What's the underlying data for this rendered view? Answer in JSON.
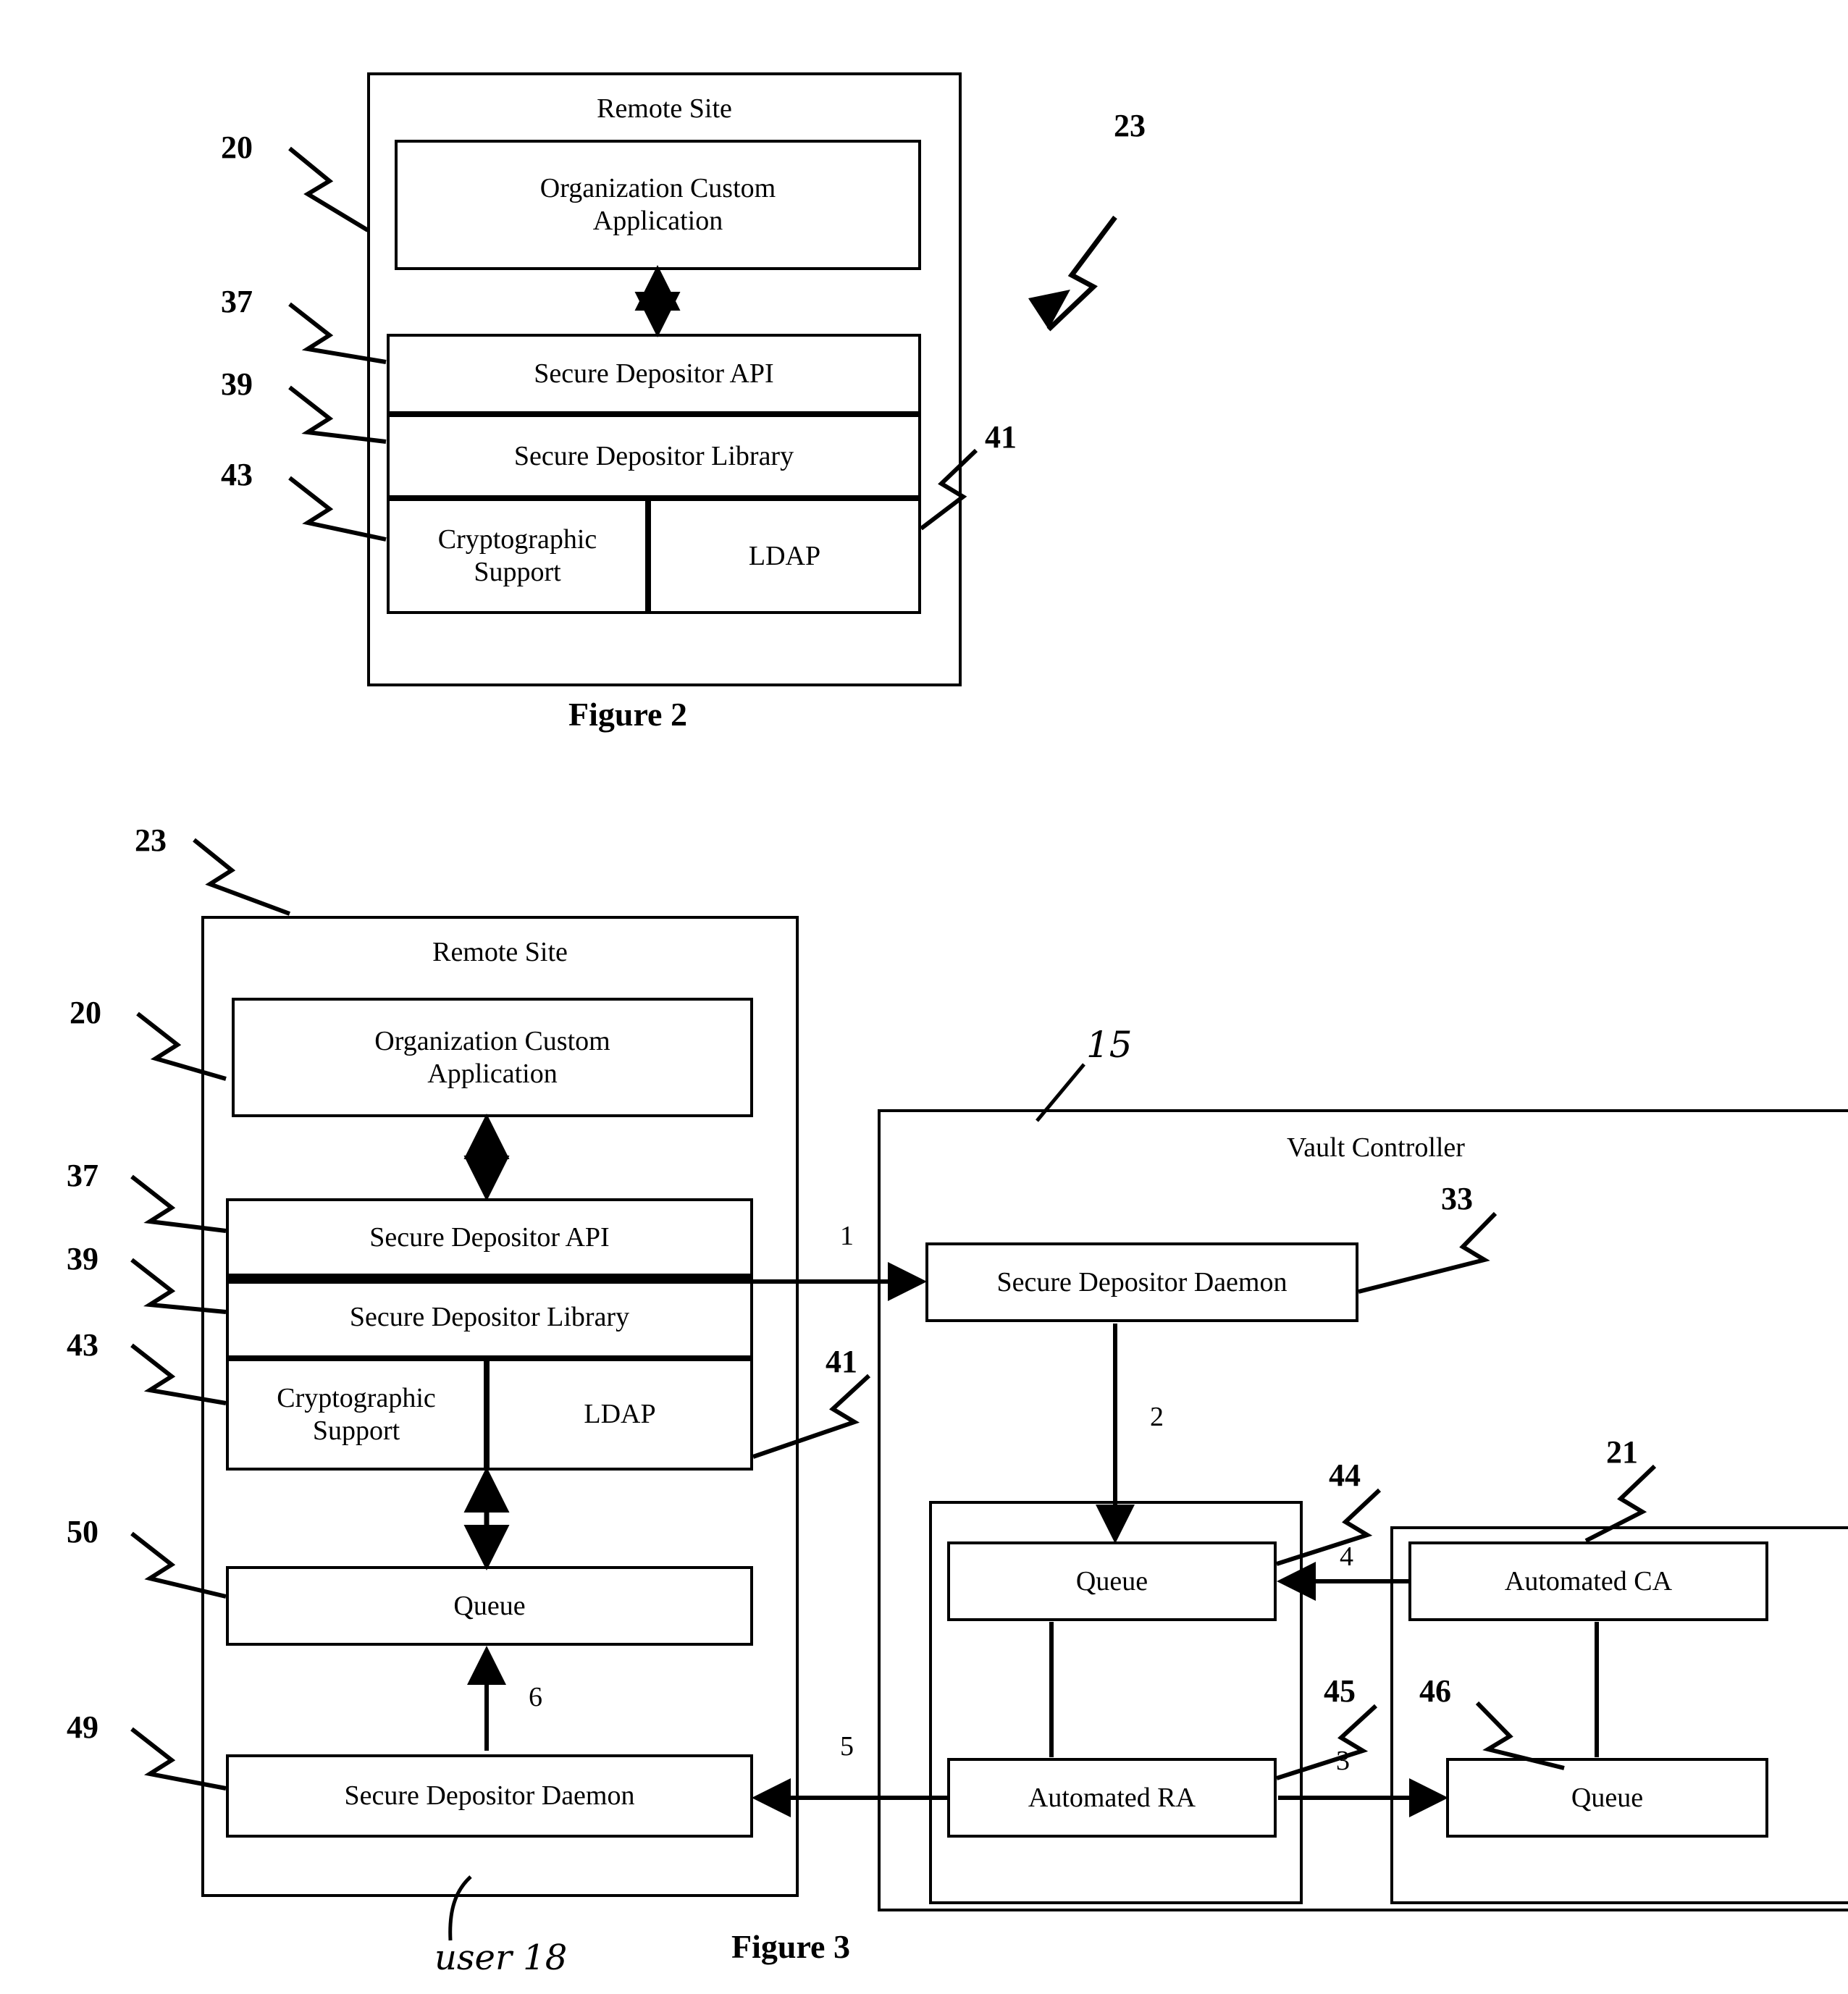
{
  "figure2": {
    "caption": "Figure 2",
    "outer_label": "Remote Site",
    "boxes": {
      "app": "Organization Custom\nApplication",
      "api": "Secure Depositor API",
      "library": "Secure Depositor Library",
      "crypto": "Cryptographic\nSupport",
      "ldap": "LDAP"
    },
    "refs": {
      "r20": "20",
      "r37": "37",
      "r39": "39",
      "r43": "43",
      "r41": "41",
      "r23": "23"
    }
  },
  "figure3": {
    "caption": "Figure 3",
    "remote_site_label": "Remote Site",
    "vault_controller_label": "Vault Controller",
    "boxes": {
      "app": "Organization Custom\nApplication",
      "api": "Secure Depositor API",
      "library": "Secure Depositor Library",
      "crypto": "Cryptographic\nSupport",
      "ldap": "LDAP",
      "queue_remote": "Queue",
      "daemon_remote": "Secure Depositor Daemon",
      "daemon_vault": "Secure Depositor Daemon",
      "queue_ra": "Queue",
      "automated_ra": "Automated RA",
      "automated_ca": "Automated CA",
      "queue_ca": "Queue"
    },
    "refs": {
      "r23": "23",
      "r20": "20",
      "r37": "37",
      "r39": "39",
      "r43": "43",
      "r50": "50",
      "r49": "49",
      "r41": "41",
      "r33": "33",
      "r44": "44",
      "r45": "45",
      "r46": "46",
      "r21": "21"
    },
    "flow_numbers": {
      "n1": "1",
      "n2": "2",
      "n3": "3",
      "n4": "4",
      "n5": "5",
      "n6": "6"
    },
    "handwritten": {
      "vault_ref": "15",
      "user_note": "user 18"
    }
  }
}
